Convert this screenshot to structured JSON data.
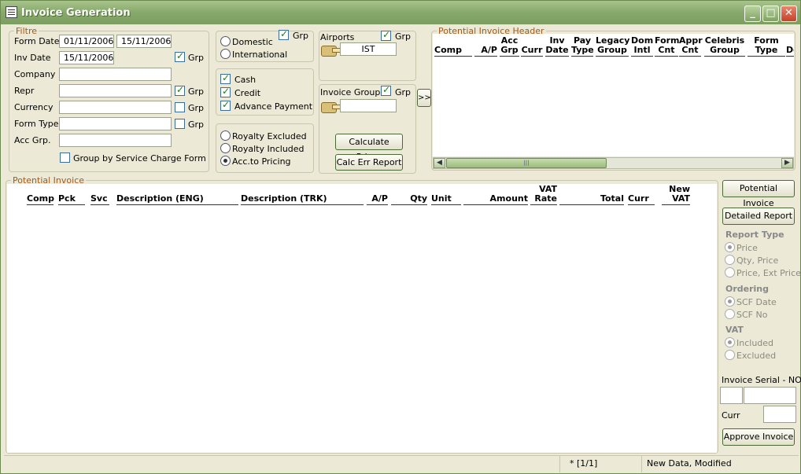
{
  "window": {
    "title": "Invoice Generation"
  },
  "filter": {
    "legend": "Filtre",
    "form_date_label": "Form Date",
    "form_date_from": "01/11/2006",
    "form_date_to": "15/11/2006",
    "inv_date_label": "Inv Date",
    "inv_date": "15/11/2006",
    "company_label": "Company",
    "repr_label": "Repr",
    "currency_label": "Currency",
    "form_type_label": "Form Type",
    "acc_grp_label": "Acc Grp.",
    "grp_label": "Grp",
    "group_by_label": "Group by Service Charge Form"
  },
  "scope": {
    "domestic": "Domestic",
    "international": "International",
    "grp": "Grp"
  },
  "payment": {
    "cash": "Cash",
    "credit": "Credit",
    "advance": "Advance Payment"
  },
  "royalty": {
    "excluded": "Royalty Excluded",
    "included": "Royalty Included",
    "acc_pricing": "Acc.to Pricing"
  },
  "airports": {
    "label": "Airports",
    "grp": "Grp",
    "value": "IST"
  },
  "invoice_groups": {
    "label": "Invoice Groups",
    "grp": "Grp",
    "value": ""
  },
  "buttons": {
    "calculate": "Calculate Prices",
    "calc_err": "Calc Err Report",
    "expand": ">>",
    "potential_invoice": "Potential Invoice",
    "detailed_report": "Detailed Report",
    "approve": "Approve Invoice"
  },
  "header_panel": {
    "legend": "Potential Invoice Header",
    "columns": [
      [
        "Comp"
      ],
      [
        "A/P"
      ],
      [
        "Acc",
        "Grp"
      ],
      [
        "Curr"
      ],
      [
        "Inv",
        "Date"
      ],
      [
        "Pay",
        "Type"
      ],
      [
        "Legacy",
        "Group"
      ],
      [
        "Dom",
        "Intl"
      ],
      [
        "Form",
        "Cnt"
      ],
      [
        "Appr",
        "Cnt"
      ],
      [
        "Celebris",
        "Group"
      ],
      [
        "Form",
        "Type"
      ],
      [
        "De"
      ]
    ]
  },
  "invoice_panel": {
    "legend": "Potential Invoice",
    "columns": [
      [
        "Comp"
      ],
      [
        "Pck"
      ],
      [
        "Svc"
      ],
      [
        "Description (ENG)"
      ],
      [
        "Description (TRK)"
      ],
      [
        "A/P"
      ],
      [
        "Qty"
      ],
      [
        "Unit"
      ],
      [
        "Amount"
      ],
      [
        "VAT",
        "Rate"
      ],
      [
        "Total"
      ],
      [
        "Curr"
      ],
      [
        "New",
        "VAT"
      ]
    ]
  },
  "report": {
    "type_label": "Report Type",
    "price": "Price",
    "qty_price": "Qty, Price",
    "price_ext": "Price, Ext Price",
    "ordering_label": "Ordering",
    "scf_date": "SCF Date",
    "scf_no": "SCF No",
    "vat_label": "VAT",
    "included": "Included",
    "excluded": "Excluded"
  },
  "serial": {
    "label": "Invoice Serial - NO",
    "curr_label": "Curr"
  },
  "status": {
    "record": "* [1/1]",
    "state": "New Data, Modified"
  }
}
